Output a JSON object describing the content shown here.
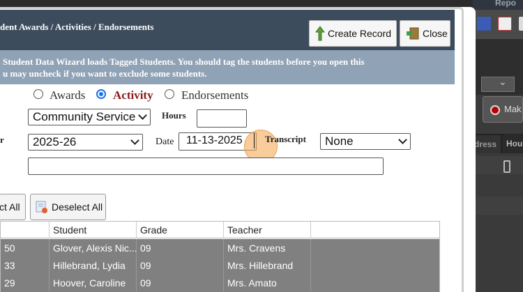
{
  "background_app": {
    "top_text": "Repo",
    "make_button_label": "Mak",
    "tab_address": "dress",
    "tab_house": "Hou"
  },
  "dialog": {
    "title": "dent Awards / Activities / Endorsements",
    "create_record_label": "Create Record",
    "close_label": "Close",
    "notice_line1": "Student Data Wizard loads Tagged Students. You should tag the students before you open this",
    "notice_line2": "u may uncheck if you want to exclude some students."
  },
  "type_options": [
    {
      "label": "Awards",
      "checked": false
    },
    {
      "label": "Activity",
      "checked": true
    },
    {
      "label": "Endorsements",
      "checked": false
    }
  ],
  "form": {
    "activity_value": "Community Service",
    "hours_label": "Hours",
    "hours_value": "",
    "year_label_fragment": "r",
    "year_value": "2025-26",
    "date_label": "Date",
    "date_value": "11-13-2025",
    "transcript_label": "Transcript",
    "transcript_value": "None",
    "description_value": ""
  },
  "buttons": {
    "select_all_label": "ct All",
    "deselect_all_label": "Deselect All"
  },
  "grid": {
    "columns": [
      "",
      "Student",
      "Grade",
      "Teacher",
      ""
    ],
    "rows": [
      {
        "id": "50",
        "student": "Glover, Alexis Nic...",
        "grade": "09",
        "teacher": "Mrs. Cravens"
      },
      {
        "id": "33",
        "student": "Hillebrand, Lydia",
        "grade": "09",
        "teacher": "Mrs. Hillebrand"
      },
      {
        "id": "29",
        "student": "Hoover, Caroline",
        "grade": "09",
        "teacher": "Mrs. Amato"
      }
    ]
  }
}
